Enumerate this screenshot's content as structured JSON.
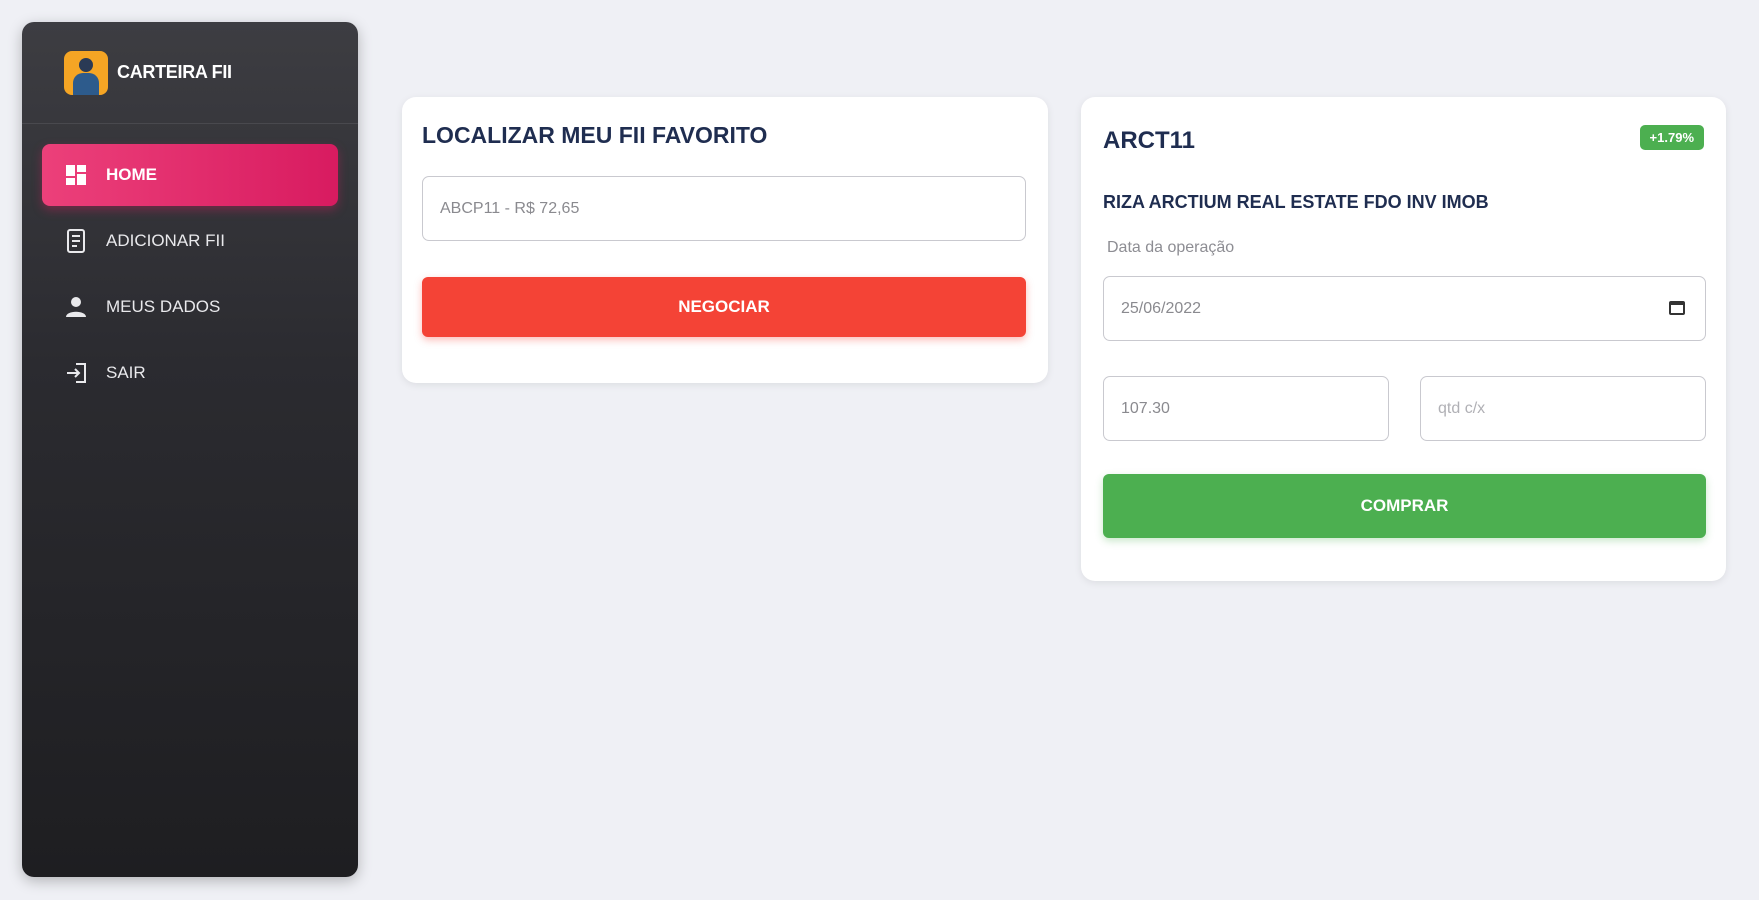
{
  "brand": {
    "name": "CARTEIRA FII"
  },
  "nav": [
    {
      "label": "HOME",
      "icon": "dashboard-icon",
      "active": true
    },
    {
      "label": "ADICIONAR FII",
      "icon": "receipt-icon",
      "active": false
    },
    {
      "label": "MEUS DADOS",
      "icon": "person-icon",
      "active": false
    },
    {
      "label": "SAIR",
      "icon": "login-icon",
      "active": false
    }
  ],
  "search": {
    "title": "LOCALIZAR MEU FII FAVORITO",
    "input_value": "ABCP11 - R$ 72,65",
    "button_label": "NEGOCIAR"
  },
  "fund": {
    "ticker": "ARCT11",
    "change_badge": "+1.79%",
    "name": "RIZA ARCTIUM REAL ESTATE FDO INV IMOB",
    "date_label": "Data da operação",
    "date_value": "25/06/2022",
    "price_value": "107.30",
    "qty_placeholder": "qtd c/x",
    "button_label": "COMPRAR"
  },
  "colors": {
    "accent_pink": "#e91e63",
    "negociar_red": "#f44336",
    "comprar_green": "#4caf50",
    "title_navy": "#1f2d50"
  }
}
